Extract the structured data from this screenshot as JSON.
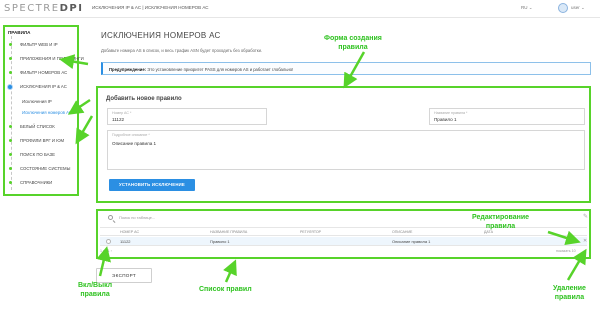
{
  "topbar": {
    "logo_light": "SPECTRE",
    "logo_bold": "DPI",
    "breadcrumb": "ИСКЛЮЧЕНИЯ IP & AC | ИСКЛЮЧЕНИЯ НОМЕРОВ АС",
    "language": "RU ⌄",
    "user": "user ⌄"
  },
  "sidebar": {
    "heading": "ПРАВИЛА",
    "items": [
      {
        "label": "ФИЛЬТР WEB И IP"
      },
      {
        "label": "ПРИЛОЖЕНИЯ И ПОЛИСИНГИ"
      },
      {
        "label": "ФИЛЬТР НОМЕРОВ АС"
      },
      {
        "label": "ИСКЛЮЧЕНИЯ IP & AC"
      },
      {
        "label": "БЕЛЫЙ СПИСОК"
      },
      {
        "label": "ПРОФИЛИ ВРГ И ЮМ"
      },
      {
        "label": "ПОИСК ПО БАЗЕ"
      },
      {
        "label": "СОСТОЯНИЕ СИСТЕМЫ"
      },
      {
        "label": "СПРАВОЧНИКИ"
      }
    ],
    "subitems": [
      {
        "label": "Исключения IP"
      },
      {
        "label": "Исключения номеров АС"
      }
    ]
  },
  "page": {
    "title": "ИСКЛЮЧЕНИЯ НОМЕРОВ АС",
    "description": "Добавьте номера AS в список, и весь трафик ASN будет проходить без обработки.",
    "warning_label": "Предупреждение:",
    "warning_text": " Это установление приоритет PASS для номеров AS и работает глобально!"
  },
  "form": {
    "title": "Добавить новое правило",
    "as_number_label": "Номер АС *",
    "as_number_value": "11122",
    "rule_name_label": "Название правила *",
    "rule_name_value": "Правило 1",
    "description_label": "Подробное описание *",
    "description_value": "Описание правила 1",
    "create_button": "УСТАНОВИТЬ ИСКЛЮЧЕНИЕ"
  },
  "table": {
    "search_placeholder": "Поиск по таблице...",
    "columns": [
      "НОМЕР АС",
      "НАЗВАНИЕ ПРАВИЛА",
      "РЕГУЛЯТОР",
      "ОПИСАНИЕ",
      "ДАТА"
    ],
    "rows": [
      {
        "as_number": "11122",
        "rule_name": "Правило 1",
        "regulator": "",
        "description": "Описание правила 1",
        "date": ""
      }
    ],
    "footer_left": "1 из 1 ›",
    "footer_right": "показать 10"
  },
  "export_button": "ЭКСПОРТ",
  "annotations": {
    "form_line1": "Форма создания",
    "form_line2": "правила",
    "edit_line1": "Редактирование",
    "edit_line2": "правила",
    "toggle_line1": "Вкл/Выкл",
    "toggle_line2": "правила",
    "list": "Список правил",
    "delete_line1": "Удаление",
    "delete_line2": "правила"
  },
  "colors": {
    "annotation_green": "#57d32a",
    "accent_blue": "#2b8fe3"
  }
}
